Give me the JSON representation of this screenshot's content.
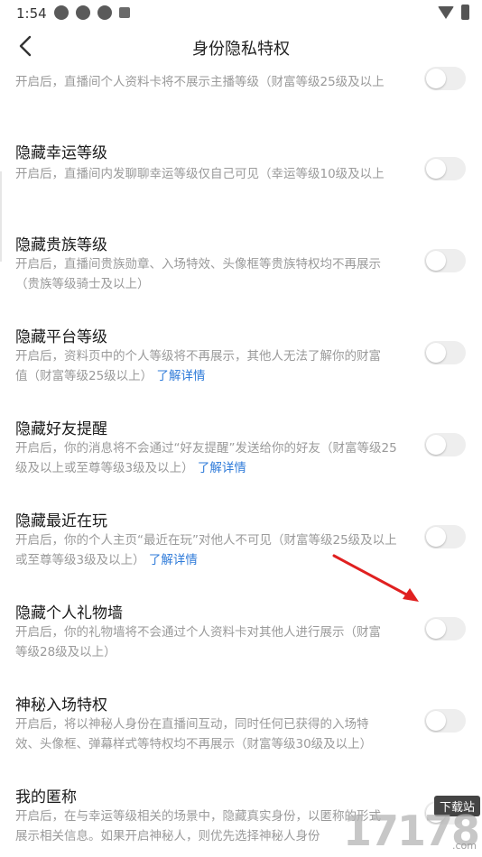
{
  "status_bar": {
    "time": "1:54",
    "notification_icons": [
      "app-icon",
      "app-icon",
      "app-icon",
      "a-icon"
    ],
    "right_icons": [
      "wifi-icon",
      "battery-icon"
    ]
  },
  "nav": {
    "title": "身份隐私特权",
    "back_icon": "chevron-left-icon"
  },
  "items": [
    {
      "title": "",
      "desc": [
        "开启后，直播间个人资料卡将不展示主播等级（财富等级25级及以上"
      ],
      "link": "",
      "toggle_on": false
    },
    {
      "title": "隐藏幸运等级",
      "desc": [
        "开启后，直播间内发聊聊幸运等级仅自己可见（幸运等级10级及以上"
      ],
      "link": "",
      "toggle_on": false
    },
    {
      "title": "隐藏贵族等级",
      "desc": [
        "开启后，直播间贵族勋章、入场特效、头像框等贵族特权均不再展示",
        "（贵族等级骑士及以上）"
      ],
      "link": "",
      "toggle_on": false
    },
    {
      "title": "隐藏平台等级",
      "desc": [
        "开启后，资料页中的个人等级将不再展示，其他人无法了解你的财富",
        "值（财富等级25级以上）"
      ],
      "link": "了解详情",
      "toggle_on": false
    },
    {
      "title": "隐藏好友提醒",
      "desc": [
        "开启后，你的消息将不会通过“好友提醒”发送给你的好友（财富等级25",
        "级及以上或至尊等级3级及以上）"
      ],
      "link": "了解详情",
      "toggle_on": false
    },
    {
      "title": "隐藏最近在玩",
      "desc": [
        "开启后，你的个人主页“最近在玩”对他人不可见（财富等级25级及以上",
        "或至尊等级3级及以上）"
      ],
      "link": "了解详情",
      "toggle_on": false
    },
    {
      "title": "隐藏个人礼物墙",
      "desc": [
        "开启后，你的礼物墙将不会通过个人资料卡对其他人进行展示（财富",
        "等级28级及以上）"
      ],
      "link": "",
      "toggle_on": false
    },
    {
      "title": "神秘入场特权",
      "desc": [
        "开启后，将以神秘人身份在直播间互动，同时任何已获得的入场特",
        "效、头像框、弹幕样式等特权均不再展示（财富等级30级及以上）"
      ],
      "link": "",
      "toggle_on": false
    },
    {
      "title": "我的匿称",
      "desc": [
        "开启后，在与幸运等级相关的场景中，隐藏真实身份，以匿称的形式",
        "展示相关信息。如果开启神秘人，则优先选择神秘人身份"
      ],
      "link": "",
      "toggle_on": false
    }
  ],
  "watermark": {
    "badge": "下载站",
    "number": "17178",
    "site": ".com"
  },
  "colors": {
    "link": "#2f7bd9",
    "toggle_off": "#eeeeee",
    "annotation_arrow": "#e02020"
  }
}
